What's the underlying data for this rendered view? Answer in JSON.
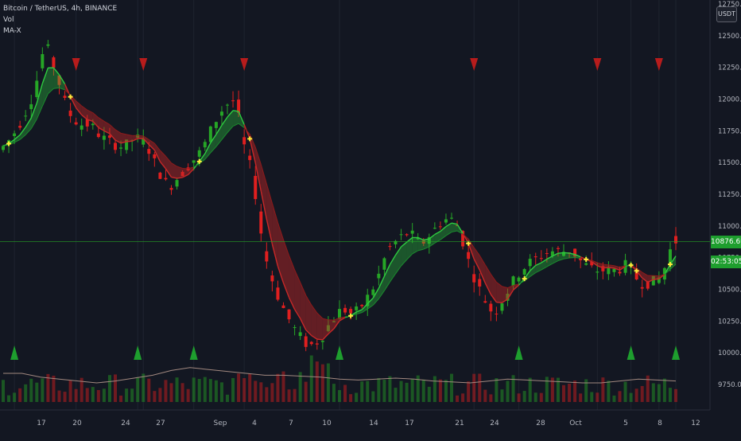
{
  "legend": {
    "symbol": "Bitcoin / TetherUS, 4h, BINANCE",
    "vol_label": "Vol",
    "indicator_label": "MA-X"
  },
  "price_axis": {
    "currency_button": "USDT",
    "ticks": [
      "12750.00",
      "12500.00",
      "12250.00",
      "12000.00",
      "11750.00",
      "11500.00",
      "11250.00",
      "11000.00",
      "10750.00",
      "10500.00",
      "10250.00",
      "10000.00",
      "9750.00"
    ]
  },
  "time_axis": {
    "ticks": [
      "17",
      "20",
      "24",
      "27",
      "Sep",
      "4",
      "7",
      "10",
      "14",
      "17",
      "21",
      "24",
      "28",
      "Oct",
      "5",
      "8",
      "12"
    ]
  },
  "current_price": {
    "value": "10876.69",
    "countdown": "02:53:05"
  },
  "colors": {
    "background": "#131722",
    "bull": "#26a626",
    "bear": "#e01f1f",
    "fast_ma": "#2ecc40",
    "slow_ma_down": "#c62828",
    "cross_marker": "#ffeb3b",
    "volume_ma": "#a1887f",
    "price_line": "#26a626"
  },
  "chart_data": {
    "type": "candlestick",
    "title": "Bitcoin / TetherUS, 4h, BINANCE",
    "ylim": [
      9600,
      12800
    ],
    "price_path": [
      [
        0,
        11600
      ],
      [
        2,
        11700
      ],
      [
        4,
        11850
      ],
      [
        6,
        12050
      ],
      [
        8,
        12450
      ],
      [
        10,
        12200
      ],
      [
        12,
        11900
      ],
      [
        14,
        11800
      ],
      [
        16,
        11800
      ],
      [
        18,
        11700
      ],
      [
        20,
        11650
      ],
      [
        22,
        11620
      ],
      [
        24,
        11700
      ],
      [
        26,
        11650
      ],
      [
        28,
        11450
      ],
      [
        30,
        11300
      ],
      [
        32,
        11400
      ],
      [
        34,
        11500
      ],
      [
        36,
        11600
      ],
      [
        38,
        11800
      ],
      [
        40,
        11950
      ],
      [
        42,
        12000
      ],
      [
        43,
        11700
      ],
      [
        45,
        11400
      ],
      [
        47,
        10800
      ],
      [
        49,
        10500
      ],
      [
        51,
        10300
      ],
      [
        53,
        10150
      ],
      [
        55,
        10050
      ],
      [
        57,
        10100
      ],
      [
        59,
        10250
      ],
      [
        61,
        10350
      ],
      [
        63,
        10300
      ],
      [
        65,
        10400
      ],
      [
        67,
        10550
      ],
      [
        69,
        10800
      ],
      [
        71,
        10900
      ],
      [
        73,
        10950
      ],
      [
        75,
        10850
      ],
      [
        77,
        10950
      ],
      [
        79,
        11050
      ],
      [
        81,
        11050
      ],
      [
        82,
        10950
      ],
      [
        84,
        10650
      ],
      [
        86,
        10450
      ],
      [
        88,
        10300
      ],
      [
        90,
        10450
      ],
      [
        92,
        10600
      ],
      [
        94,
        10700
      ],
      [
        96,
        10750
      ],
      [
        98,
        10800
      ],
      [
        100,
        10800
      ],
      [
        102,
        10800
      ],
      [
        104,
        10700
      ],
      [
        106,
        10650
      ],
      [
        108,
        10650
      ],
      [
        110,
        10650
      ],
      [
        112,
        10700
      ],
      [
        114,
        10550
      ],
      [
        116,
        10550
      ],
      [
        118,
        10600
      ],
      [
        120,
        10880
      ]
    ],
    "sell_signals_index": [
      13,
      25,
      43,
      84,
      106,
      117
    ],
    "buy_signals_index": [
      2,
      24,
      34,
      60,
      92,
      112,
      120
    ],
    "volume_ma": [
      0.3,
      0.3,
      0.26,
      0.24,
      0.22,
      0.2,
      0.22,
      0.25,
      0.28,
      0.33,
      0.36,
      0.34,
      0.32,
      0.3,
      0.28,
      0.28,
      0.27,
      0.26,
      0.24,
      0.23,
      0.24,
      0.25,
      0.24,
      0.22,
      0.21,
      0.2,
      0.22,
      0.24,
      0.23,
      0.22,
      0.21,
      0.2,
      0.2,
      0.22,
      0.24,
      0.23,
      0.22
    ]
  }
}
